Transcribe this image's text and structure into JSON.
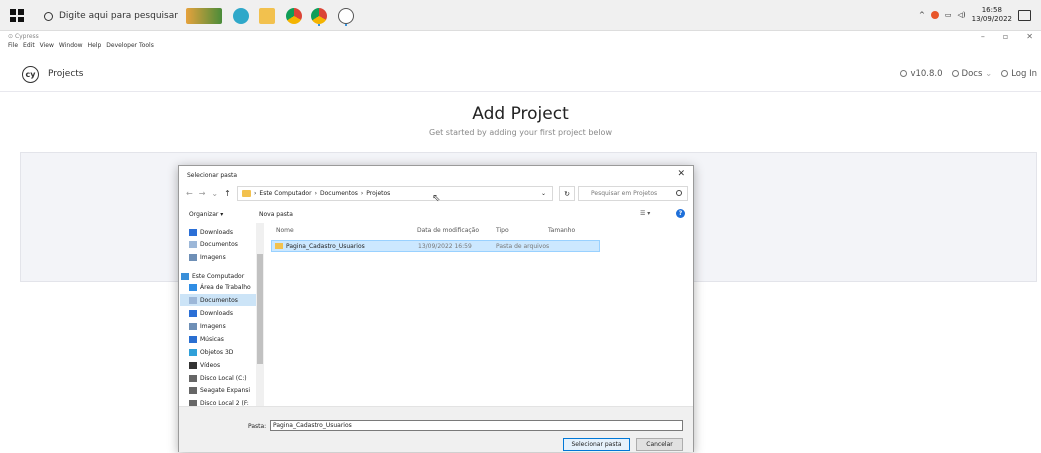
{
  "taskbar": {
    "search_placeholder": "Digite aqui para pesquisar",
    "tray_time": "16:58",
    "tray_date": "13/09/2022"
  },
  "app": {
    "window_title": "Cypress",
    "menu": [
      "File",
      "Edit",
      "View",
      "Window",
      "Help",
      "Developer Tools"
    ]
  },
  "cypress": {
    "header_title": "Projects",
    "version": "v10.8.0",
    "docs": "Docs",
    "login": "Log In",
    "hero_title": "Add Project",
    "hero_subtitle": "Get started by adding your first project below"
  },
  "dialog": {
    "title": "Selecionar pasta",
    "breadcrumb": [
      "Este Computador",
      "Documentos",
      "Projetos"
    ],
    "search_placeholder": "Pesquisar em Projetos",
    "organize": "Organizar ▾",
    "new_folder": "Nova pasta",
    "nav_items": [
      {
        "label": "Downloads",
        "icon": "download-icon"
      },
      {
        "label": "Documentos",
        "icon": "document-icon"
      },
      {
        "label": "Imagens",
        "icon": "image-icon"
      },
      {
        "label": "Este Computador",
        "icon": "computer-icon"
      },
      {
        "label": "Área de Trabalho",
        "icon": "desktop-icon"
      },
      {
        "label": "Documentos",
        "icon": "document-icon"
      },
      {
        "label": "Downloads",
        "icon": "download-icon"
      },
      {
        "label": "Imagens",
        "icon": "image-icon"
      },
      {
        "label": "Músicas",
        "icon": "music-icon"
      },
      {
        "label": "Objetos 3D",
        "icon": "cube-icon"
      },
      {
        "label": "Vídeos",
        "icon": "video-icon"
      },
      {
        "label": "Disco Local (C:)",
        "icon": "drive-icon"
      },
      {
        "label": "Seagate Expansi",
        "icon": "drive-icon"
      },
      {
        "label": "Disco Local 2 (F:",
        "icon": "drive-icon"
      }
    ],
    "columns": [
      "Nome",
      "Data de modificação",
      "Tipo",
      "Tamanho"
    ],
    "files": [
      {
        "name": "Pagina_Cadastro_Usuarios",
        "modified": "13/09/2022 16:59",
        "type": "Pasta de arquivos",
        "size": ""
      }
    ],
    "folder_label": "Pasta:",
    "folder_value": "Pagina_Cadastro_Usuarios",
    "select_button": "Selecionar pasta",
    "cancel_button": "Cancelar"
  },
  "colors": {
    "selection": "#cce8ff",
    "primary_button_border": "#0078d7",
    "folder": "#f2c14e"
  }
}
